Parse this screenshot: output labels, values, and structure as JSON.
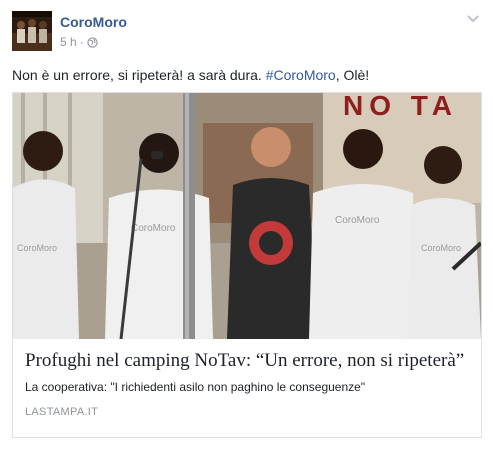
{
  "post": {
    "page_name": "CoroMoro",
    "timestamp": "5 h",
    "separator": "·",
    "privacy_icon": "globe-icon",
    "menu_icon": "chevron-down-icon",
    "text_before_hashtag": "Non è un errore, si ripeterà! a sarà dura. ",
    "hashtag": "#CoroMoro",
    "text_after_hashtag": ", Olè!"
  },
  "link": {
    "image_text": "NO TA",
    "shirt_logo": "CoroMoro",
    "title": "Profughi nel camping NoTav: “Un errore, non si ripeterà”",
    "description": "La cooperativa: \"I richiedenti asilo non paghino le conseguenze\"",
    "source": "LASTAMPA.IT"
  },
  "colors": {
    "link_blue": "#365899",
    "meta_gray": "#90949c",
    "text": "#1d2129",
    "border": "#dddfe2"
  }
}
